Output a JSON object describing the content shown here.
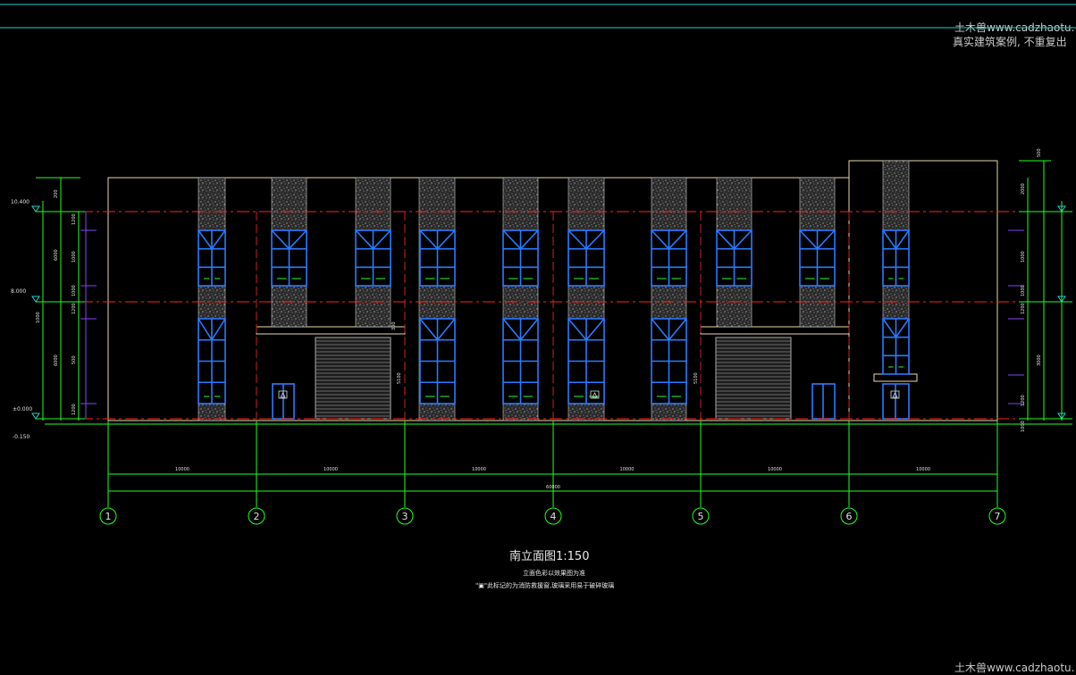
{
  "watermark": {
    "line1": "土木兽www.cadzhaotu.",
    "line2": "真实建筑案例, 不重复出",
    "line3": "土木兽www.cadzhaotu."
  },
  "drawing": {
    "title": "南立面图1:150",
    "note1": "立面色彩以效果图为准",
    "note2": "\"▣\"此标记的为消防救援窗,玻璃采用易于破碎玻璃",
    "axes": [
      "1",
      "2",
      "3",
      "4",
      "5",
      "6",
      "7"
    ],
    "spans": [
      "10000",
      "10000",
      "10000",
      "10000",
      "10000",
      "10000"
    ],
    "total": "60000",
    "levels_left": [
      "10.400",
      "8.000",
      "±0.000",
      "-0.150"
    ],
    "dims_left_outer": [
      "200",
      "6000",
      "1000",
      "6000",
      "1200"
    ],
    "dims_left_inner": [
      "1200",
      "1000",
      "1000",
      "1200",
      "500",
      "1200"
    ],
    "dims_right": [
      "500",
      "2000",
      "1000",
      "1000",
      "1200",
      "3000",
      "1200",
      "1000"
    ],
    "door_dims": [
      "300",
      "5100",
      "5100"
    ]
  },
  "colors": {
    "background": "#000000",
    "wall": "#e8d8a8",
    "window": "#2a7bff",
    "dimension": "#22ff22",
    "level_line": "#ff2222",
    "column": "#cc2222",
    "cyan_line": "#22d0d0",
    "purple": "#8844ff"
  }
}
